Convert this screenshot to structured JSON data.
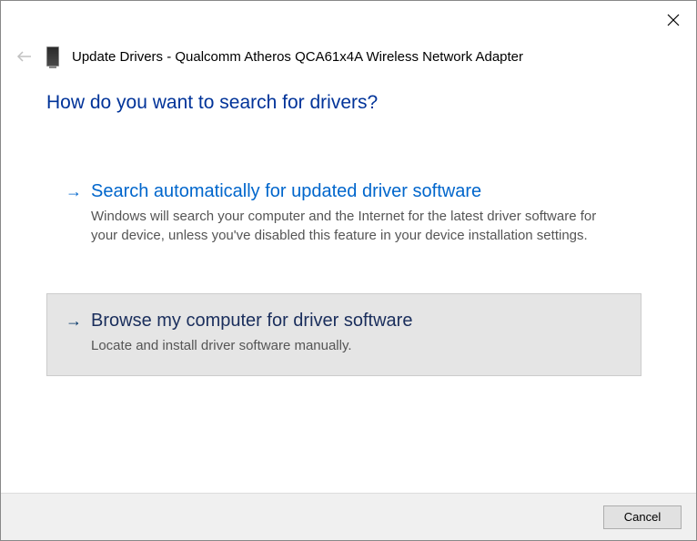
{
  "header": {
    "title": "Update Drivers - Qualcomm Atheros QCA61x4A Wireless Network Adapter"
  },
  "main": {
    "heading": "How do you want to search for drivers?",
    "options": [
      {
        "title": "Search automatically for updated driver software",
        "description": "Windows will search your computer and the Internet for the latest driver software for your device, unless you've disabled this feature in your device installation settings."
      },
      {
        "title": "Browse my computer for driver software",
        "description": "Locate and install driver software manually."
      }
    ]
  },
  "footer": {
    "cancel_label": "Cancel"
  }
}
